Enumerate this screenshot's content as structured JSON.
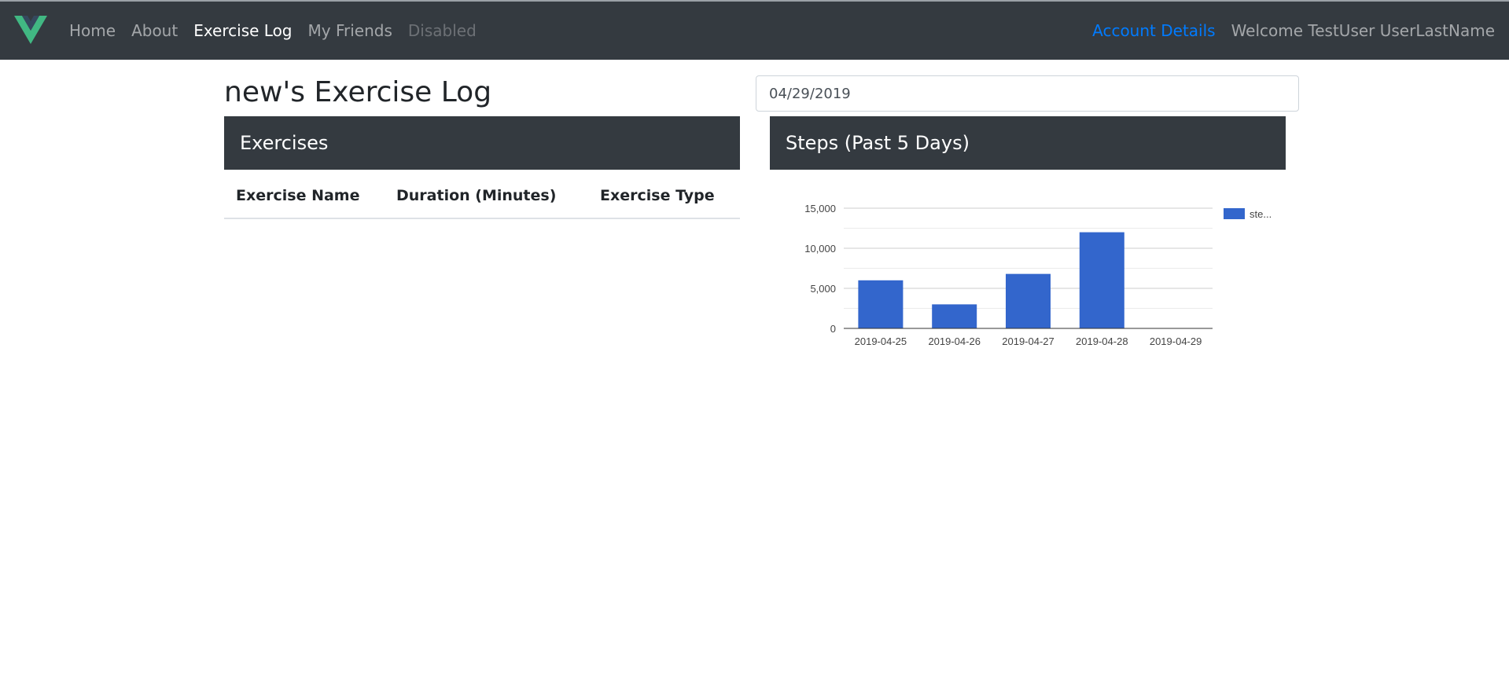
{
  "navbar": {
    "links": [
      {
        "label": "Home"
      },
      {
        "label": "About"
      },
      {
        "label": "Exercise Log"
      },
      {
        "label": "My Friends"
      },
      {
        "label": "Disabled"
      }
    ],
    "active_index": 2,
    "account_label": "Account Details",
    "welcome_text": "Welcome TestUser UserLastName",
    "colors": {
      "bar_bg": "#343a40",
      "brand_green": "#41b883",
      "brand_dark": "#35495e",
      "link_accent": "#007bff"
    }
  },
  "page": {
    "title": "new's Exercise Log",
    "date_value": "04/29/2019"
  },
  "exercises": {
    "header": "Exercises",
    "columns": [
      "Exercise Name",
      "Duration (Minutes)",
      "Exercise Type"
    ],
    "rows": []
  },
  "steps": {
    "header": "Steps (Past 5 Days)"
  },
  "chart_data": {
    "type": "bar",
    "categories": [
      "2019-04-25",
      "2019-04-26",
      "2019-04-27",
      "2019-04-28",
      "2019-04-29"
    ],
    "series": [
      {
        "name": "ste...",
        "values": [
          6000,
          3000,
          6800,
          12000,
          0
        ],
        "color": "#3366cc"
      }
    ],
    "yticks": [
      "0",
      "5,000",
      "10,000",
      "15,000"
    ],
    "ylim": [
      0,
      15000
    ],
    "grid": true,
    "legend": "right"
  }
}
